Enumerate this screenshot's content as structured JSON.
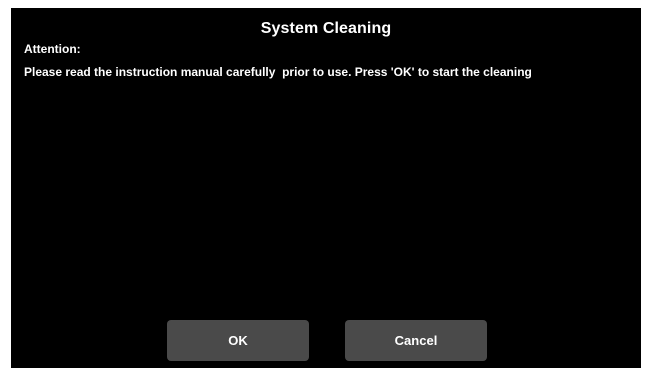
{
  "dialog": {
    "title": "System Cleaning",
    "attention_label": "Attention:",
    "message": "Please read the instruction manual carefully  prior to use. Press 'OK' to start the cleaning"
  },
  "buttons": {
    "ok_label": "OK",
    "cancel_label": "Cancel"
  },
  "colors": {
    "background": "#000000",
    "text": "#ffffff",
    "button": "#4a4a4a"
  }
}
